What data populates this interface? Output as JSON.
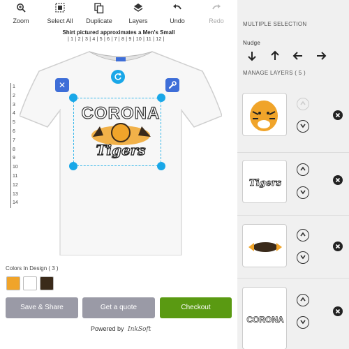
{
  "toolbar": {
    "zoom": "Zoom",
    "select_all": "Select All",
    "duplicate": "Duplicate",
    "layers": "Layers",
    "undo": "Undo",
    "redo": "Redo"
  },
  "canvas": {
    "size_note": "Shirt pictured approximates a Men's Small",
    "h_ruler": "| 1 | 2 | 3 | 4 | 5 | 6 | 7 | 8 | 9 | 10 | 11 | 12 |",
    "v_ruler": [
      "1",
      "2",
      "3",
      "4",
      "5",
      "6",
      "7",
      "8",
      "9",
      "10",
      "11",
      "12",
      "13",
      "14"
    ],
    "design": {
      "line1": "CORONA",
      "line2": "Tigers"
    }
  },
  "colors": {
    "label": "Colors In Design ( 3 )",
    "swatches": [
      "#f0a42a",
      "#ffffff",
      "#3a2a1a"
    ]
  },
  "buttons": {
    "save_share": "Save & Share",
    "get_quote": "Get a quote",
    "checkout": "Checkout"
  },
  "footer": {
    "powered_by": "Powered by",
    "brand": "InkSoft"
  },
  "panel": {
    "multiple_selection": "MULTIPLE SELECTION",
    "nudge": "Nudge",
    "manage_layers": "MANAGE LAYERS ( 5 )",
    "layers": [
      {
        "name": "tiger-head"
      },
      {
        "name": "tigers-text",
        "text": "Tigers"
      },
      {
        "name": "claw-tear"
      },
      {
        "name": "corona-text",
        "text": "CORONA"
      }
    ]
  }
}
